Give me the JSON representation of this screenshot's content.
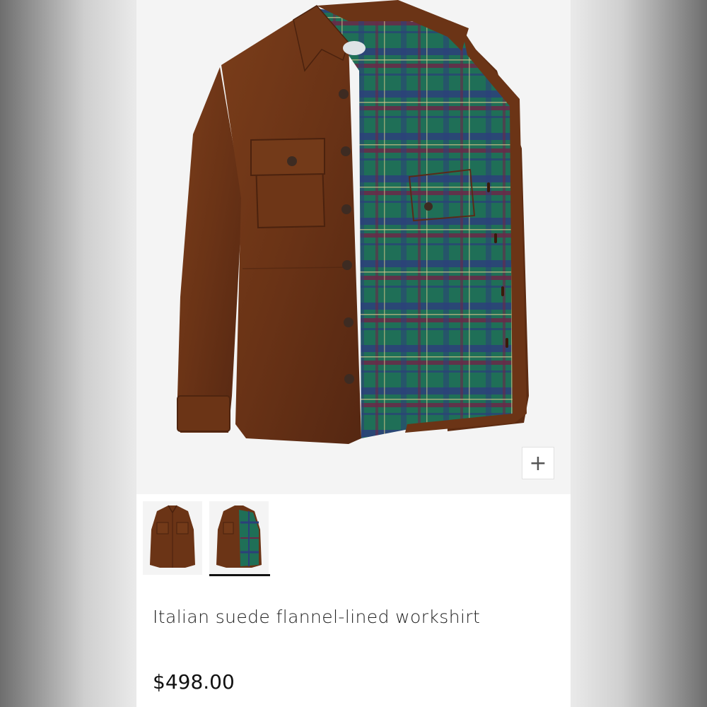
{
  "product": {
    "title": "Italian suede flannel-lined workshirt",
    "price": "$498.00"
  },
  "gallery": {
    "zoom_label": "+",
    "selected_thumbnail": 2,
    "thumbnails": [
      "front",
      "open-lining"
    ]
  },
  "colors": {
    "suede": "#6b3416",
    "flannel_green": "#1d6b55",
    "flannel_check": "#5a2d55",
    "background": "#f4f4f4"
  }
}
